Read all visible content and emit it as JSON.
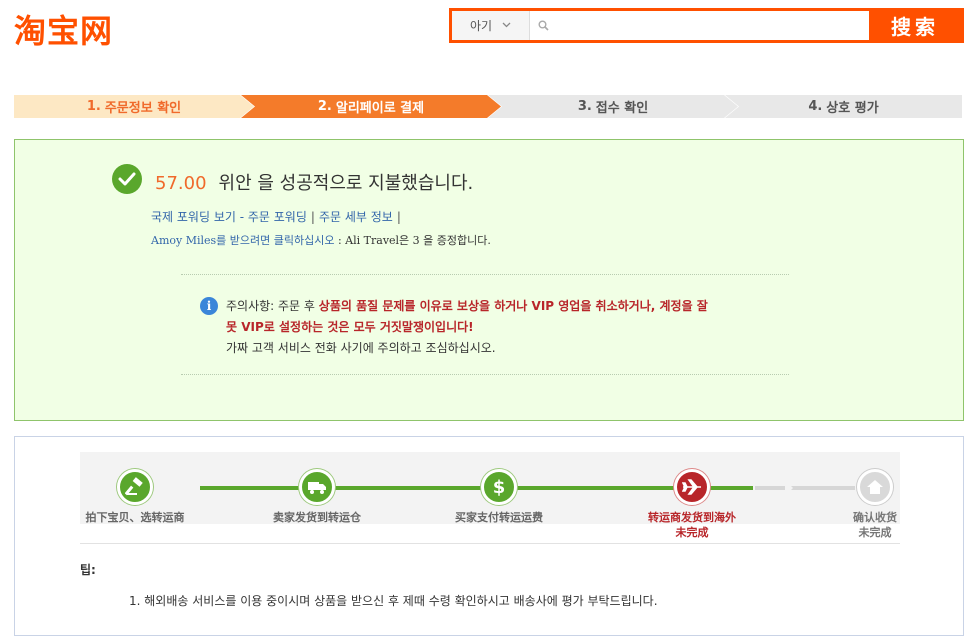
{
  "header": {
    "logo_text": "淘宝网",
    "search_category": "아기",
    "search_placeholder": "",
    "search_button": "搜索"
  },
  "steps": [
    {
      "num": "1.",
      "label": "주문정보 확인"
    },
    {
      "num": "2.",
      "label": "알리페이로 결제"
    },
    {
      "num": "3.",
      "label": "접수 확인"
    },
    {
      "num": "4.",
      "label": "상호 평가"
    }
  ],
  "success": {
    "amount": "57.00",
    "message": "위안 을 성공적으로 지불했습니다.",
    "link_forwarding": "국제 포워딩 보기 - 주문 포워딩",
    "link_order_detail": "주문 세부 정보",
    "amoy_link": "Amoy Miles를 받으려면 클릭하십시오",
    "amoy_text": " : Ali Travel은 3 을 증정합니다.",
    "notice_prefix": "주의사항: 주문 후 ",
    "notice_red_1": "상품의 품질 문제를 이유로 보상을 하거나 VIP 영업을 취소하거나, 계정을 잘못 VIP로 설정하는 것은 모두 거짓말쟁이입니다!",
    "notice_line_3": "가짜 고객 서비스 전화 사기에 주의하고 조심하십시오."
  },
  "progress": {
    "nodes": [
      {
        "label": "拍下宝贝、选转运商",
        "sub": "",
        "state": "done",
        "icon": "hammer-icon"
      },
      {
        "label": "卖家发货到转运仓",
        "sub": "",
        "state": "done",
        "icon": "truck-icon"
      },
      {
        "label": "买家支付转运运费",
        "sub": "",
        "state": "done",
        "icon": "dollar-icon"
      },
      {
        "label": "转运商发货到海外",
        "sub": "未完成",
        "state": "current",
        "icon": "airplane-icon"
      },
      {
        "label": "确认收货",
        "sub": "未完成",
        "state": "todo",
        "icon": "home-icon"
      }
    ],
    "tip_title": "팁:",
    "tip_item": "1. 해외배송 서비스를 이용 중이시며 상품을 받으신 후 제때 수령 확인하시고 배송사에 평가 부탁드립니다."
  },
  "colors": {
    "brand": "#ff5000",
    "success_green": "#5aa72c",
    "alert_red": "#b8262a",
    "link_blue": "#3366aa"
  }
}
